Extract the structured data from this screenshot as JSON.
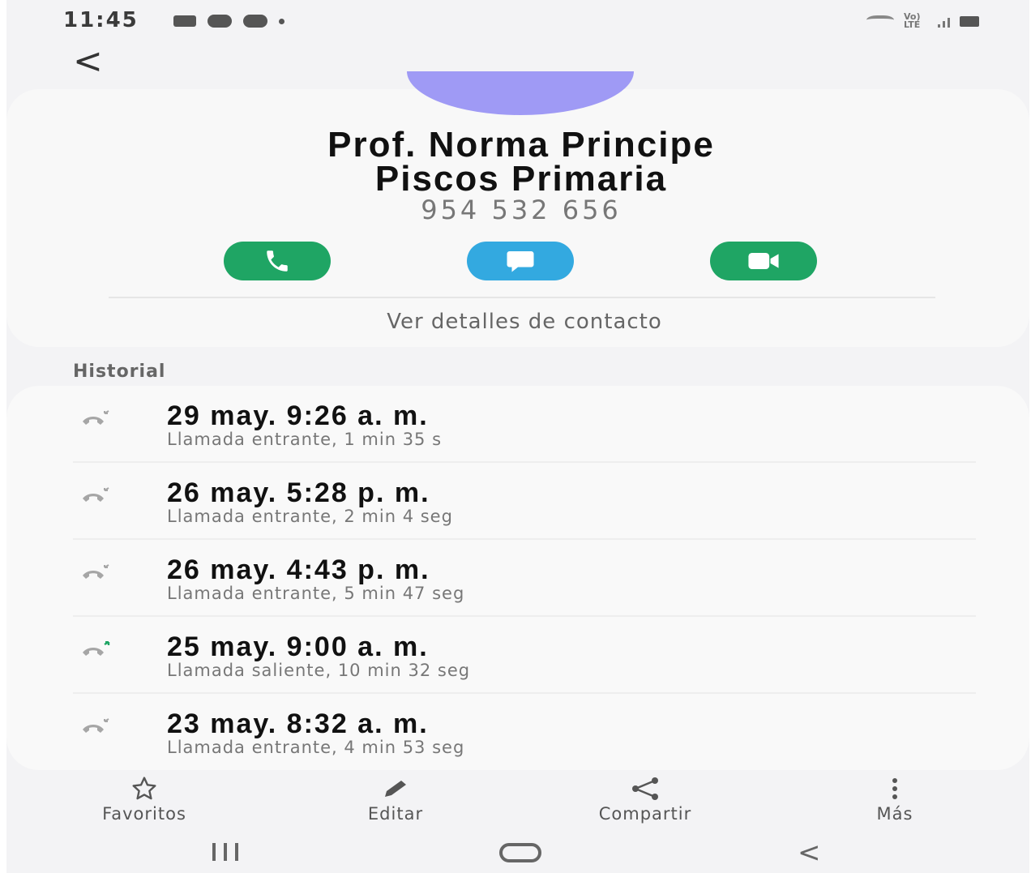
{
  "status_bar": {
    "time": "11:45",
    "network_label": "Vo) LTE"
  },
  "contact": {
    "name_line1": "Prof. Norma Principe",
    "name_line2": "Piscos Primaria",
    "phone": "954 532 656",
    "avatar_color": "#9f9af5",
    "details_link": "Ver detalles de contacto",
    "actions": {
      "call_icon": "phone-icon",
      "message_icon": "message-icon",
      "video_icon": "video-icon"
    }
  },
  "history": {
    "label": "Historial",
    "entries": [
      {
        "title": "29 may. 9:26 a. m.",
        "subtitle": "Llamada entrante, 1 min 35 s",
        "direction": "incoming"
      },
      {
        "title": "26 may. 5:28 p. m.",
        "subtitle": "Llamada entrante, 2 min 4 seg",
        "direction": "incoming"
      },
      {
        "title": "26 may. 4:43 p. m.",
        "subtitle": "Llamada entrante, 5 min 47 seg",
        "direction": "incoming"
      },
      {
        "title": "25 may. 9:00 a. m.",
        "subtitle": "Llamada saliente, 10 min 32 seg",
        "direction": "outgoing"
      },
      {
        "title": "23 may. 8:32 a. m.",
        "subtitle": "Llamada entrante, 4 min 53 seg",
        "direction": "incoming"
      }
    ]
  },
  "bottom_bar": {
    "favorites": "Favoritos",
    "edit": "Editar",
    "share": "Compartir",
    "more": "Más"
  },
  "colors": {
    "call_green": "#1fa564",
    "message_blue": "#33a9e0",
    "incoming_icon": "#9a9a9a",
    "outgoing_icon": "#1fa564"
  }
}
